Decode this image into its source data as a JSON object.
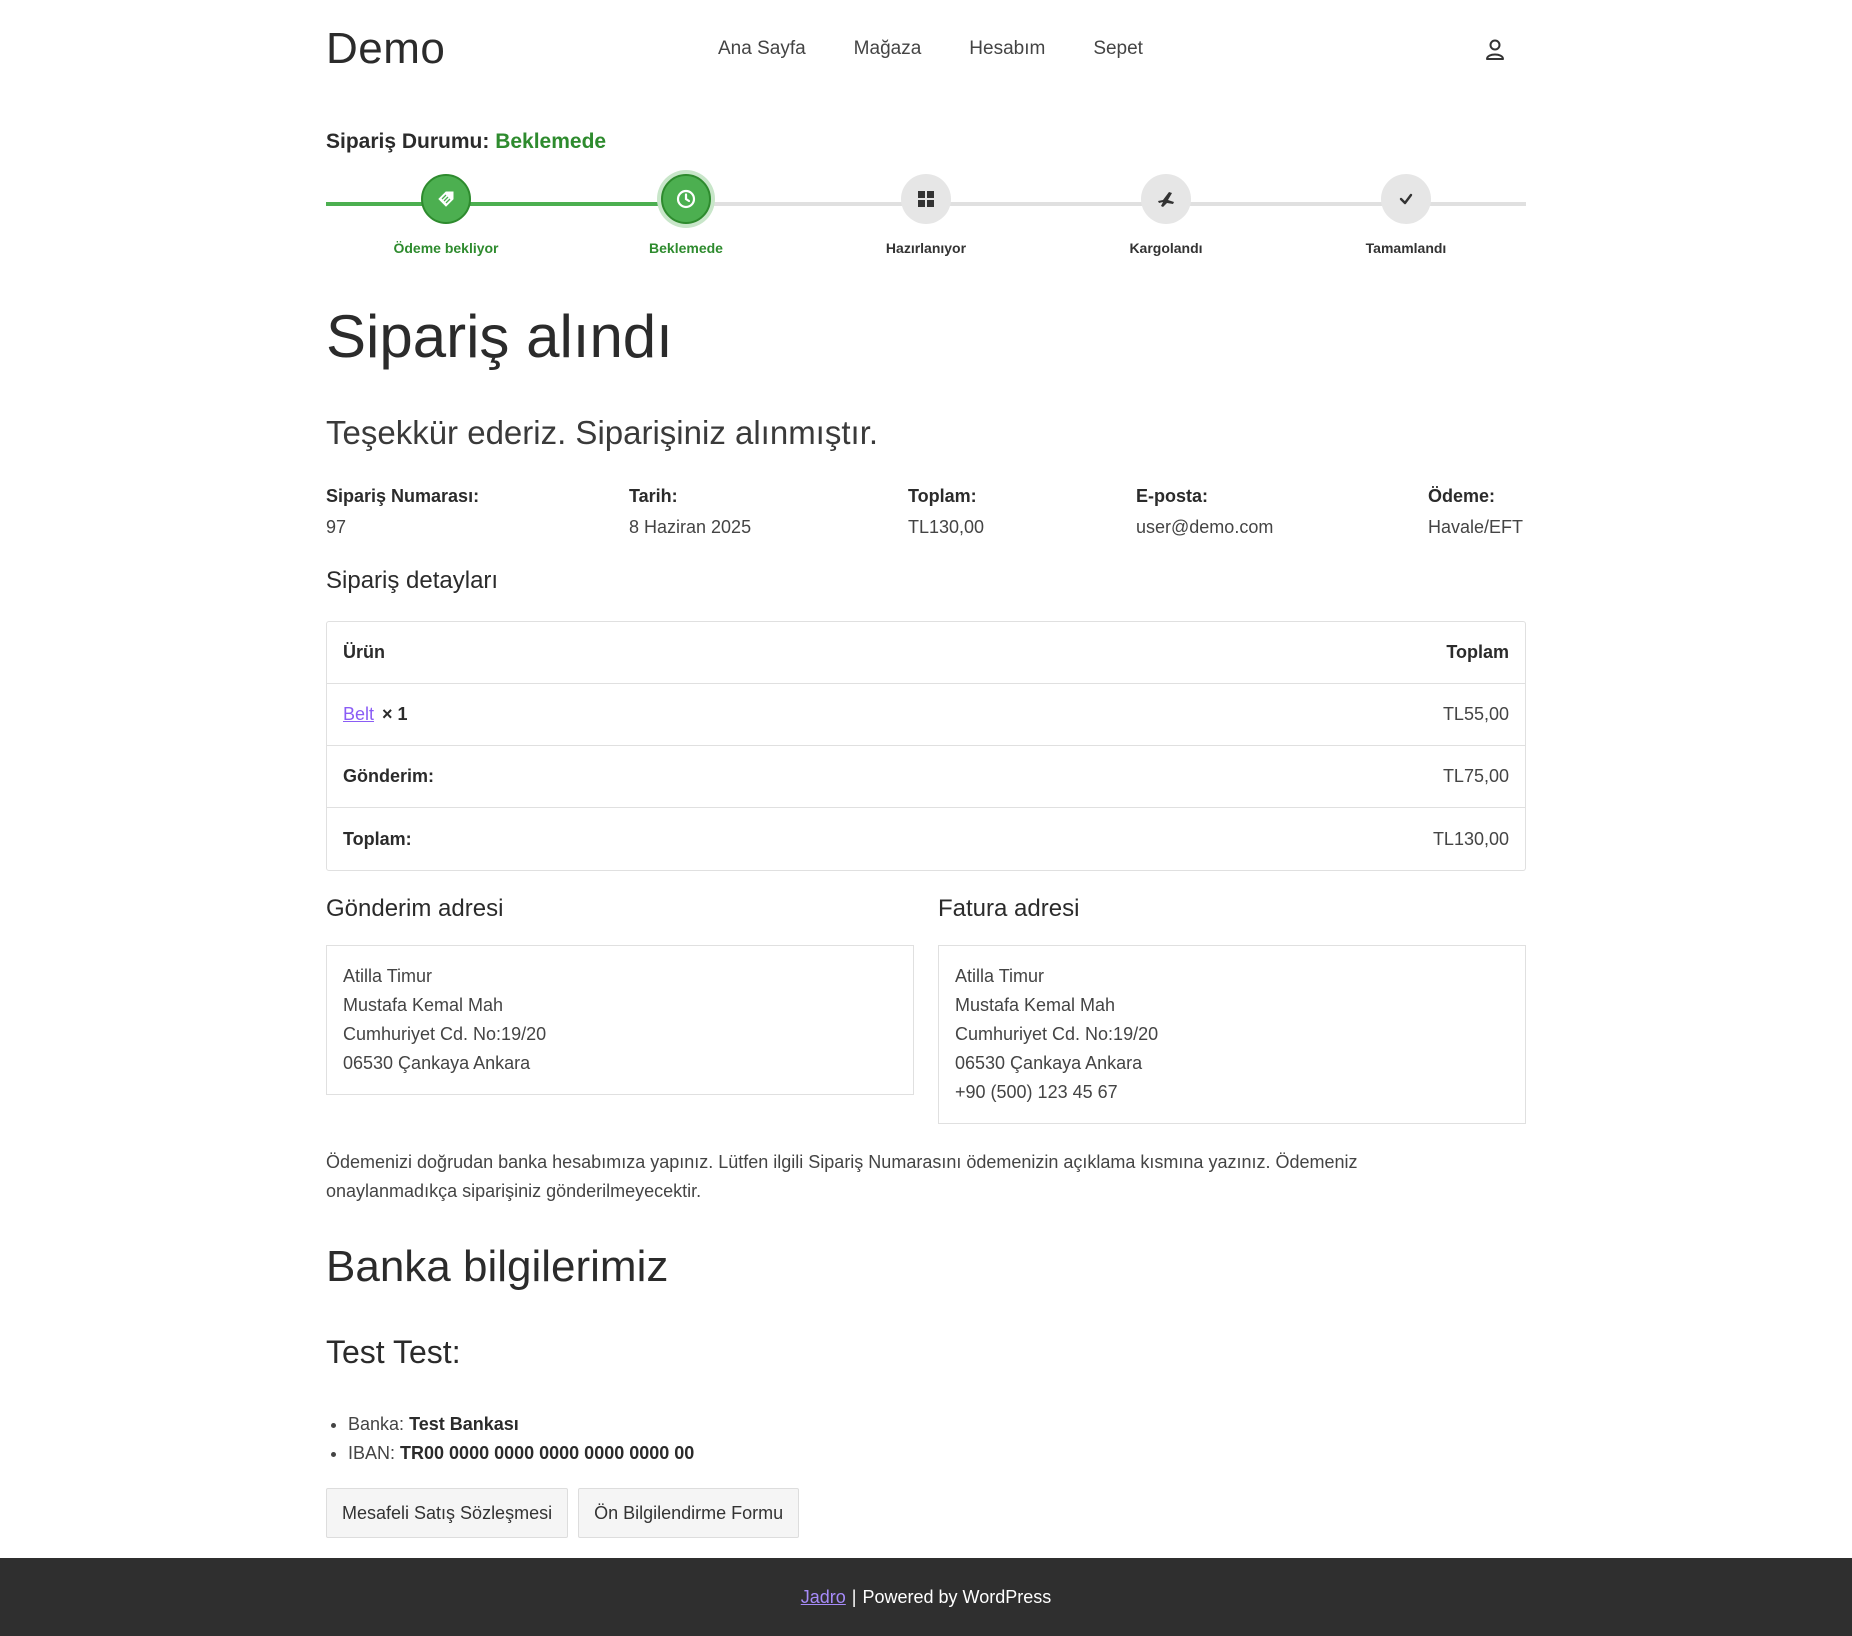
{
  "header": {
    "logo": "Demo",
    "nav": [
      "Ana Sayfa",
      "Mağaza",
      "Hesabım",
      "Sepet"
    ]
  },
  "status": {
    "label": "Sipariş Durumu:",
    "value": "Beklemede",
    "steps": [
      {
        "label": "Ödeme bekliyor",
        "icon": "tag-icon",
        "state": "done"
      },
      {
        "label": "Beklemede",
        "icon": "clock-icon",
        "state": "current"
      },
      {
        "label": "Hazırlanıyor",
        "icon": "grid-icon",
        "state": "pending"
      },
      {
        "label": "Kargolandı",
        "icon": "plane-icon",
        "state": "pending"
      },
      {
        "label": "Tamamlandı",
        "icon": "check-icon",
        "state": "pending"
      }
    ],
    "progress": 0.3
  },
  "page_title": "Sipariş alındı",
  "thanks": "Teşekkür ederiz. Siparişiniz alınmıştır.",
  "overview": [
    {
      "label": "Sipariş Numarası:",
      "value": "97"
    },
    {
      "label": "Tarih:",
      "value": "8 Haziran 2025"
    },
    {
      "label": "Toplam:",
      "value": "TL130,00"
    },
    {
      "label": "E-posta:",
      "value": "user@demo.com"
    },
    {
      "label": "Ödeme:",
      "value": "Havale/EFT"
    }
  ],
  "details": {
    "heading": "Sipariş detayları",
    "col_product": "Ürün",
    "col_total": "Toplam",
    "item": {
      "name": "Belt",
      "qty": "× 1",
      "total": "TL55,00"
    },
    "shipping": {
      "label": "Gönderim:",
      "value": "TL75,00"
    },
    "total": {
      "label": "Toplam:",
      "value": "TL130,00"
    }
  },
  "shipping_address": {
    "heading": "Gönderim adresi",
    "lines": [
      "Atilla Timur",
      "Mustafa Kemal Mah",
      "Cumhuriyet Cd. No:19/20",
      "06530 Çankaya Ankara"
    ]
  },
  "billing_address": {
    "heading": "Fatura adresi",
    "lines": [
      "Atilla Timur",
      "Mustafa Kemal Mah",
      "Cumhuriyet Cd. No:19/20",
      "06530 Çankaya Ankara",
      "+90 (500) 123 45 67"
    ]
  },
  "payment_note_1": "Ödemenizi doğrudan banka hesabımıza yapınız. Lütfen ilgili Sipariş Numarasını ödemenizin açıklama kısmına yazınız. Ödemeniz",
  "payment_note_2": "onaylanmadıkça siparişiniz gönderilmeyecektir.",
  "bank": {
    "heading": "Banka bilgilerimiz",
    "account_name": "Test Test:",
    "bank_label": "Banka:",
    "bank_value": "Test Bankası",
    "iban_label": "IBAN:",
    "iban_value": "TR00 0000 0000 0000 0000 0000 00"
  },
  "buttons": {
    "contract": "Mesafeli Satış Sözleşmesi",
    "preinfo": "Ön Bilgilendirme Formu"
  },
  "footer": {
    "link": "Jadro",
    "sep": "|",
    "text": "Powered by WordPress"
  },
  "colors": {
    "accent_green": "#4caf50",
    "status_green": "#2e8b2e",
    "link_purple": "#8a5cf5",
    "footer_bg": "#2f2f2f"
  }
}
